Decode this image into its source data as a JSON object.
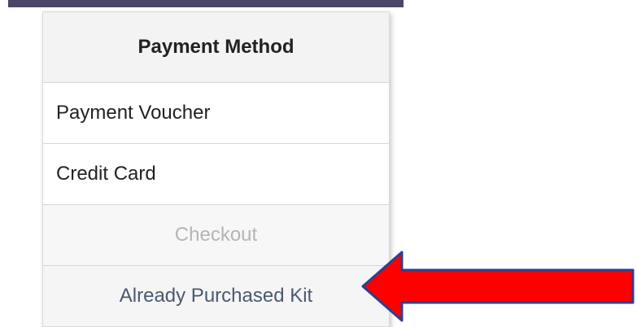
{
  "menu": {
    "header": "Payment Method",
    "items": [
      {
        "label": "Payment Voucher"
      },
      {
        "label": "Credit Card"
      },
      {
        "label": "Checkout"
      },
      {
        "label": "Already Purchased Kit"
      }
    ]
  },
  "colors": {
    "top_bar": "#4b4668",
    "arrow_fill": "#ff0000",
    "arrow_stroke": "#2e3f8f",
    "disabled_text": "#b5b5b5",
    "link_text": "#4a5a70"
  },
  "annotation": {
    "icon": "red-arrow-left-icon"
  }
}
